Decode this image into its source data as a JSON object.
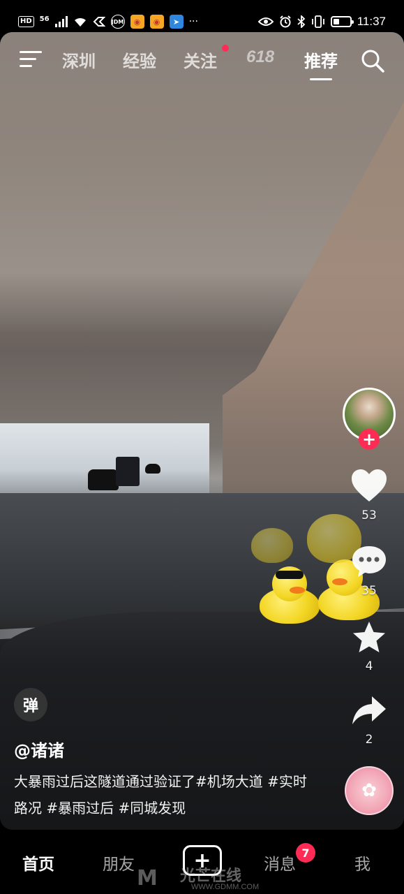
{
  "status_bar": {
    "left_icons": [
      "HD",
      "56",
      "signal-icon",
      "wifi-icon",
      "vpn-icon",
      "jdm-icon",
      "weibo-icon",
      "weibo-icon",
      "location-app-icon",
      "more-icon"
    ],
    "hd_label": "HD",
    "network_label": "56",
    "more_label": "···",
    "time": "11:37",
    "battery_level": 0.35
  },
  "top_nav": {
    "tabs": [
      {
        "label": "深圳",
        "active": false
      },
      {
        "label": "经验",
        "active": false
      },
      {
        "label": "关注",
        "active": false,
        "dot": true
      },
      {
        "label": "618",
        "active": false
      },
      {
        "label": "推荐",
        "active": true
      }
    ]
  },
  "sidebar": {
    "likes": "53",
    "comments": "35",
    "favorites": "4",
    "shares": "2",
    "follow_label": "+"
  },
  "video_info": {
    "danmu_label": "弹",
    "author": "@诸诸",
    "caption": "大暴雨过后这隧道通过验证了#机场大道 #实时路况 #暴雨过后 #同城发现"
  },
  "tab_bar": {
    "tabs": [
      {
        "label": "首页",
        "active": true
      },
      {
        "label": "朋友",
        "active": false
      },
      {
        "label": "消息",
        "active": false,
        "badge": "7"
      },
      {
        "label": "我",
        "active": false
      }
    ],
    "create_label": "+"
  },
  "watermark": {
    "text": "光芒在线",
    "url": "WWW.GDMM.COM"
  },
  "colors": {
    "accent": "#fe2c55",
    "background": "#000000",
    "text": "#ffffff"
  }
}
